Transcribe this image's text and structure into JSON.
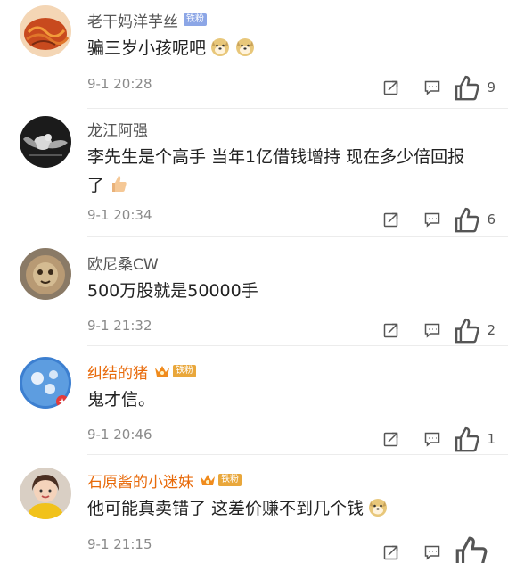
{
  "comments": [
    {
      "username": "老干妈洋芋丝",
      "badge": "铁粉",
      "text": "骗三岁小孩呢吧",
      "emojis": [
        "doge-icon",
        "doge-icon"
      ],
      "time": "9-1 20:28",
      "likes": "9"
    },
    {
      "username": "龙江阿强",
      "text": "李先生是个高手 当年1亿借钱增持 现在多少倍回报了",
      "emojis": [
        "thumbs-up-icon"
      ],
      "time": "9-1 20:34",
      "likes": "6"
    },
    {
      "username": "欧尼桑CW",
      "text": "500万股就是50000手",
      "time": "9-1 21:32",
      "likes": "2"
    },
    {
      "username": "纠结的猪",
      "badge": "铁粉",
      "text": "鬼才信。",
      "time": "9-1 20:46",
      "likes": "1"
    },
    {
      "username": "石原酱的小迷妹",
      "badge": "铁粉",
      "text": "他可能真卖错了 这差价赚不到几个钱",
      "emojis": [
        "doge-icon"
      ],
      "time": "9-1 21:15",
      "likes": ""
    }
  ],
  "colors": {
    "vip_name": "#e86b0c",
    "normal_name": "#555555",
    "badge_blue": "#8ca6e6",
    "badge_gold": "#e9a73b"
  },
  "icons": {
    "repost": "repost-icon",
    "comment": "comment-icon",
    "like": "like-icon"
  }
}
